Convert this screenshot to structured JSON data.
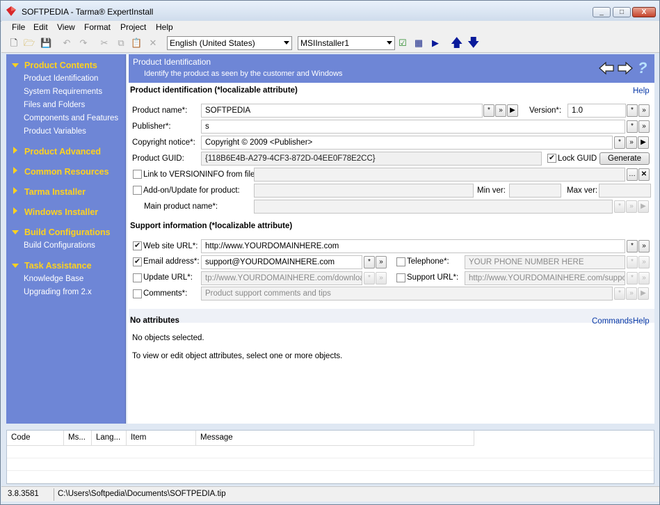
{
  "window": {
    "title": "SOFTPEDIA - Tarma® ExpertInstall",
    "controls": {
      "minimize": "_",
      "maximize": "□",
      "close": "X"
    }
  },
  "menu": [
    "File",
    "Edit",
    "View",
    "Format",
    "Project",
    "Help"
  ],
  "toolbar": {
    "language": "English (United States)",
    "installer": "MSIInstaller1"
  },
  "nav": {
    "groups": [
      {
        "label": "Product Contents",
        "expanded": true,
        "items": [
          "Product Identification",
          "System Requirements",
          "Files and Folders",
          "Components and Features",
          "Product Variables"
        ]
      },
      {
        "label": "Product Advanced",
        "expanded": false,
        "items": []
      },
      {
        "label": "Common Resources",
        "expanded": false,
        "items": []
      },
      {
        "label": "Tarma Installer",
        "expanded": false,
        "items": []
      },
      {
        "label": "Windows Installer",
        "expanded": false,
        "items": []
      },
      {
        "label": "Build Configurations",
        "expanded": true,
        "items": [
          "Build Configurations"
        ]
      },
      {
        "label": "Task Assistance",
        "expanded": true,
        "items": [
          "Knowledge Base",
          "Upgrading from 2.x"
        ]
      }
    ]
  },
  "header": {
    "title": "Product Identification",
    "subtitle": "Identify the product as seen by the customer and Windows",
    "help_glyph": "?"
  },
  "product_identification": {
    "title": "Product identification (*localizable attribute)",
    "help": "Help",
    "product_name_label": "Product name*:",
    "product_name": "SOFTPEDIA",
    "version_label": "Version*:",
    "version": "1.0",
    "publisher_label": "Publisher*:",
    "publisher": "s",
    "copyright_label": "Copyright notice*:",
    "copyright": "Copyright © 2009 <Publisher>",
    "guid_label": "Product GUID:",
    "guid": "{118B6E4B-A279-4CF3-872D-04EE0F78E2CC}",
    "lock_guid_label": "Lock GUID",
    "lock_guid": true,
    "generate_label": "Generate",
    "versioninfo_label": "Link to VERSIONINFO from file:",
    "addon_label": "Add-on/Update for product:",
    "min_ver_label": "Min ver:",
    "max_ver_label": "Max ver:",
    "main_product_label": "Main product name*:"
  },
  "support": {
    "title": "Support information (*localizable attribute)",
    "website_label": "Web site URL*:",
    "website": "http://www.YOURDOMAINHERE.com",
    "website_checked": true,
    "email_label": "Email address*:",
    "email": "support@YOURDOMAINHERE.com",
    "email_checked": true,
    "telephone_label": "Telephone*:",
    "telephone_placeholder": "YOUR PHONE NUMBER HERE",
    "update_label": "Update URL*:",
    "update_placeholder": "tp://www.YOURDOMAINHERE.com/download",
    "support_url_label": "Support URL*:",
    "support_url_placeholder": "http://www.YOURDOMAINHERE.com/support",
    "comments_label": "Comments*:",
    "comments_placeholder": "Product support comments and tips"
  },
  "attributes": {
    "title": "No attributes",
    "commands": "Commands",
    "help": "Help",
    "line1": "No objects selected.",
    "line2": "To view or edit object attributes, select one or more objects."
  },
  "messages": {
    "columns": [
      "Code",
      "Ms...",
      "Lang...",
      "Item",
      "Message"
    ]
  },
  "status": {
    "version": "3.8.3581",
    "path": "C:\\Users\\Softpedia\\Documents\\SOFTPEDIA.tip"
  },
  "colors": {
    "panel_blue": "#6e86d6",
    "nav_header_yellow": "#ffd21f",
    "link_blue": "#0a3aa8"
  }
}
